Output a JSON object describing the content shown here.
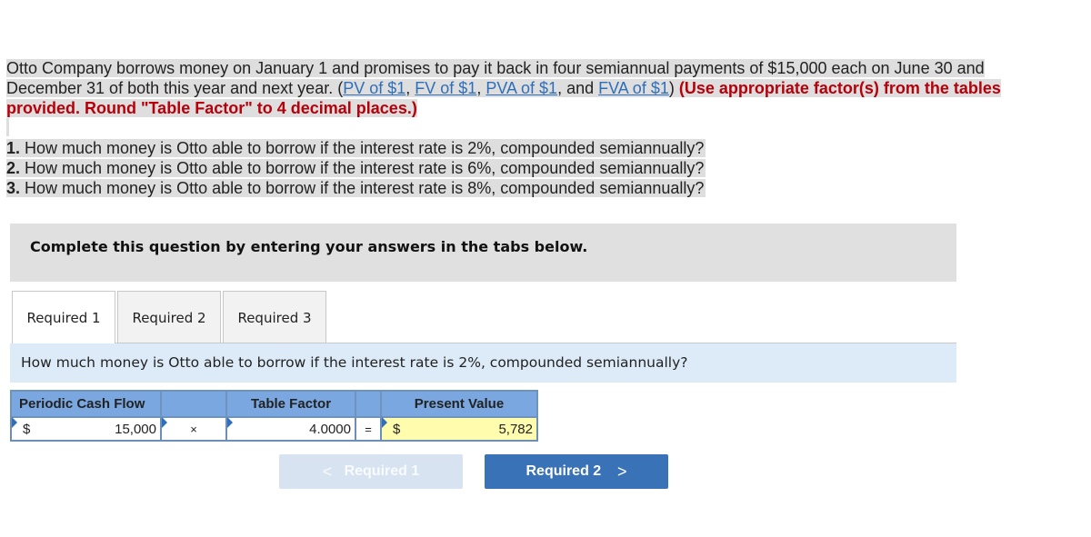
{
  "intro": {
    "text_1": "Otto Company borrows money on January 1 and promises to pay it back in four semiannual payments of $15,000 each on June 30 and December 31 of both this year and next year. (",
    "links": [
      "PV of $1",
      "FV of $1",
      "PVA of $1",
      "FVA of $1"
    ],
    "sep_1": ", ",
    "sep_2": ", ",
    "sep_3": ", and ",
    "close_paren": ")",
    "instruction": " (Use appropriate factor(s) from the tables provided. Round \"Table Factor\" to 4 decimal places.)"
  },
  "questions": [
    {
      "num": "1.",
      "text": " How much money is Otto able to borrow if the interest rate is 2%, compounded semiannually?"
    },
    {
      "num": "2.",
      "text": " How much money is Otto able to borrow if the interest rate is 6%, compounded semiannually?"
    },
    {
      "num": "3.",
      "text": " How much money is Otto able to borrow if the interest rate is 8%, compounded semiannually?"
    }
  ],
  "banner": "Complete this question by entering your answers in the tabs below.",
  "tabs": [
    {
      "label": "Required 1",
      "active": true
    },
    {
      "label": "Required 2",
      "active": false
    },
    {
      "label": "Required 3",
      "active": false
    }
  ],
  "prompt": "How much money is Otto able to borrow if the interest rate is 2%, compounded semiannually?",
  "table": {
    "headers": [
      "Periodic Cash Flow",
      "",
      "Table Factor",
      "",
      "Present Value"
    ],
    "row": {
      "cash_currency": "$",
      "cash_value": "15,000",
      "multiply_op": "×",
      "factor_value": "4.0000",
      "equals_op": "=",
      "pv_currency": "$",
      "pv_value": "5,782"
    }
  },
  "nav": {
    "prev_label": "Required 1",
    "prev_chevron": "<",
    "next_label": "Required 2",
    "next_chevron": ">"
  }
}
